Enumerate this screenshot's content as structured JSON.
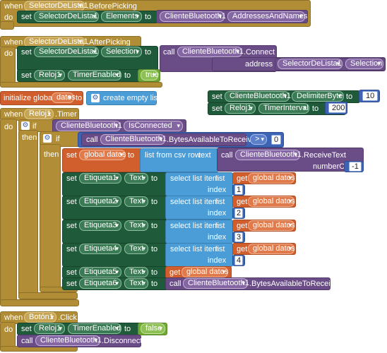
{
  "keywords": {
    "when": "when",
    "do": "do",
    "set": "set",
    "to": "to",
    "call": "call",
    "if": "if",
    "then": "then",
    "get": "get",
    "initialize_global": "initialize global",
    "create_empty_list": "create empty list",
    "list_from_csv_row": "list from csv row",
    "text": "text",
    "select_list_item": "select list item",
    "list": "list",
    "index": "index",
    "address": "address",
    "number_of_bytes": "numberOfBytes"
  },
  "block1": {
    "component": "SelectorDeLista1",
    "event": ".BeforePicking",
    "set_component": "SelectorDeLista1",
    "set_property": "Elements",
    "call_component": "ClienteBluetooth1",
    "call_property": "AddressesAndNames"
  },
  "block2": {
    "component": "SelectorDeLista1",
    "event": ".AfterPicking",
    "set_component": "SelectorDeLista1",
    "set_property": "Selection",
    "call_component": "ClienteBluetooth1",
    "call_method": ".Connect",
    "address_component": "SelectorDeLista1",
    "address_property": "Selection",
    "timer_component": "Reloj1",
    "timer_property": "TimerEnabled",
    "timer_value": "true"
  },
  "global_init": {
    "name": "datos"
  },
  "block3": {
    "component1": "ClienteBluetooth1",
    "property1": "DelimiterByte",
    "value1": "10",
    "component2": "Reloj1",
    "property2": "TimerInterval",
    "value2": "200"
  },
  "block4": {
    "component": "Reloj1",
    "event": ".Timer",
    "cond_component": "ClienteBluetooth1",
    "cond_property": "IsConnected",
    "inner_component": "ClienteBluetooth1",
    "inner_method": ".BytesAvailableToReceive",
    "operator": ">",
    "threshold": "0",
    "global_var": "global datos",
    "receive_component": "ClienteBluetooth1",
    "receive_method": ".ReceiveText",
    "receive_bytes": "-1",
    "labels": [
      {
        "component": "Etiqueta1",
        "property": "Text",
        "index": "1"
      },
      {
        "component": "Etiqueta2",
        "property": "Text",
        "index": "2"
      },
      {
        "component": "Etiqueta3",
        "property": "Text",
        "index": "3"
      },
      {
        "component": "Etiqueta4",
        "property": "Text",
        "index": "4"
      }
    ],
    "label5": {
      "component": "Etiqueta5",
      "property": "Text"
    },
    "label6": {
      "component": "Etiqueta6",
      "property": "Text",
      "call_component": "ClienteBluetooth1",
      "call_method": ".BytesAvailableToReceive"
    }
  },
  "block5": {
    "component": "Botón1",
    "event": ".Click",
    "timer_component": "Reloj1",
    "timer_property": "TimerEnabled",
    "timer_value": "false",
    "call_component": "ClienteBluetooth1",
    "call_method": ".Disconnect"
  }
}
